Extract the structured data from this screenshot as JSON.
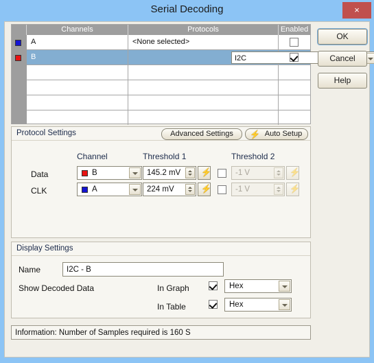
{
  "window": {
    "title": "Serial Decoding",
    "close_label": "×",
    "accent_titlebar": "#8cc4f5",
    "accent_close": "#c0504d"
  },
  "buttons": {
    "ok": "OK",
    "cancel": "Cancel",
    "help": "Help"
  },
  "channel_table": {
    "headers": {
      "corner": "",
      "channels": "Channels",
      "protocols": "Protocols",
      "enabled": "Enabled"
    },
    "rows": [
      {
        "channel": "A",
        "swatch": "#1414d2",
        "protocol": "<None selected>",
        "enabled": false,
        "selected": false,
        "has_combo": false
      },
      {
        "channel": "B",
        "swatch": "#e81313",
        "protocol": "I2C",
        "enabled": true,
        "selected": true,
        "has_combo": true
      },
      {
        "channel": "",
        "swatch": "",
        "protocol": "",
        "enabled": null,
        "selected": false,
        "has_combo": false
      },
      {
        "channel": "",
        "swatch": "",
        "protocol": "",
        "enabled": null,
        "selected": false,
        "has_combo": false
      },
      {
        "channel": "",
        "swatch": "",
        "protocol": "",
        "enabled": null,
        "selected": false,
        "has_combo": false
      },
      {
        "channel": "",
        "swatch": "",
        "protocol": "",
        "enabled": null,
        "selected": false,
        "has_combo": false
      }
    ]
  },
  "protocol_settings": {
    "title": "Protocol Settings",
    "advanced_settings": "Advanced Settings",
    "auto_setup": "Auto Setup",
    "auto_setup_icon": "bolt-icon",
    "columns": {
      "channel": "Channel",
      "threshold1": "Threshold 1",
      "threshold2": "Threshold 2"
    },
    "rows": [
      {
        "label": "Data",
        "channel": "B",
        "channel_swatch": "#e81313",
        "threshold1": "145.2 mV",
        "threshold2_enabled": false,
        "threshold2": "-1 V"
      },
      {
        "label": "CLK",
        "channel": "A",
        "channel_swatch": "#1414d2",
        "threshold1": "224 mV",
        "threshold2_enabled": false,
        "threshold2": "-1 V"
      }
    ]
  },
  "display_settings": {
    "title": "Display Settings",
    "name_label": "Name",
    "name_value": "I2C - B",
    "show_decoded_label": "Show Decoded Data",
    "in_graph_label": "In Graph",
    "in_graph_checked": true,
    "in_graph_format": "Hex",
    "in_table_label": "In Table",
    "in_table_checked": true,
    "in_table_format": "Hex"
  },
  "info": {
    "text": "Information: Number of Samples required is 160 S"
  }
}
